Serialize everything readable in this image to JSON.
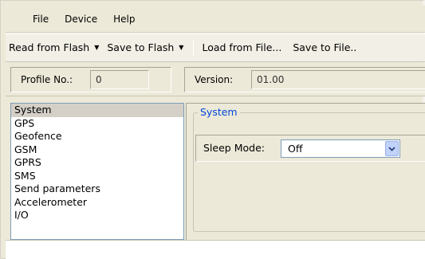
{
  "menubar": {
    "items": [
      "File",
      "Device",
      "Help"
    ]
  },
  "toolbar": {
    "read_flash": "Read from Flash",
    "save_flash": "Save to Flash",
    "load_file": "Load from File...",
    "save_file": "Save to File.."
  },
  "profile": {
    "profile_label": "Profile No.:",
    "profile_value": "0",
    "version_label": "Version:",
    "version_value": "01.00"
  },
  "nav": {
    "items": [
      "System",
      "GPS",
      "Geofence",
      "GSM",
      "GPRS",
      "SMS",
      "Send parameters",
      "Accelerometer",
      "I/O"
    ],
    "selected": "System"
  },
  "panel": {
    "group_title": "System",
    "sleep_label": "Sleep Mode:",
    "sleep_value": "Off"
  },
  "colors": {
    "group_title": "#0046d5",
    "selection": "#d4d0c8",
    "dropdown_button": "#c1d3fb"
  }
}
